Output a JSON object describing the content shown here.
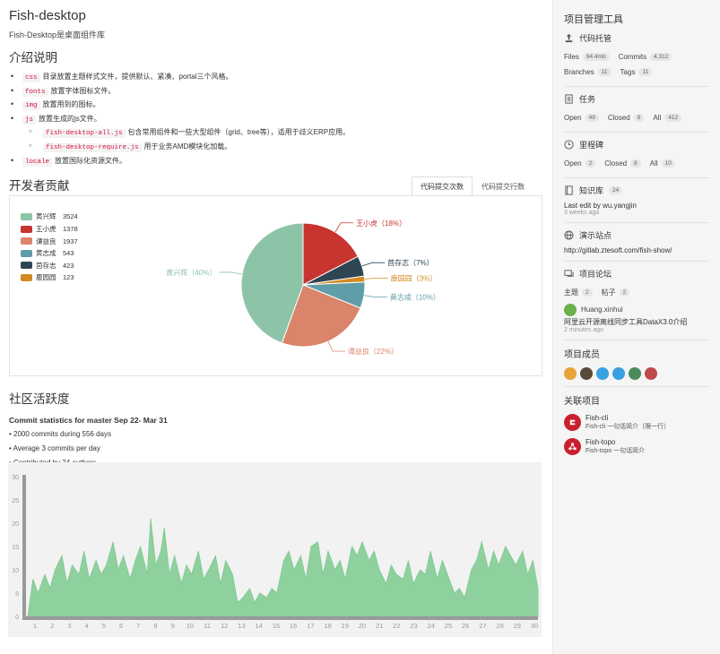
{
  "repo": {
    "title": "Fish-desktop",
    "description": "Fish-Desktop是桌面组件库"
  },
  "intro": {
    "heading": "介绍说明",
    "items": [
      {
        "code": "css",
        "text": "目录放置主题样式文件，提供默认、紧凑、portal三个风格。"
      },
      {
        "code": "fonts",
        "text": "放置字体图标文件。"
      },
      {
        "code": "img",
        "text": "放置用到的图标。"
      },
      {
        "code": "js",
        "text": "放置生成的js文件。"
      },
      {
        "code": "fish-desktop-all.js",
        "text": "包含常用组件和一些大型组件（grid、tree等），适用于歧义ERP应用。"
      },
      {
        "code": "fish-desktop-require.js",
        "text": "用于业务AMD模块化加载。"
      },
      {
        "code": "locale",
        "text": "放置国际化资源文件。"
      }
    ]
  },
  "contributors": {
    "heading": "开发者贡献",
    "tabs": [
      "代码提交次数",
      "代码提交行数"
    ]
  },
  "chart_data": [
    {
      "type": "pie",
      "categories": [
        "黄兴辉",
        "王小虎",
        "谭益良",
        "黄志成",
        "茴存志",
        "鹿园园"
      ],
      "values": [
        3524,
        1378,
        1937,
        543,
        423,
        123
      ],
      "slice_labels": [
        "黄兴辉（40%）",
        "王小虎（18%）",
        "谭益良（22%）",
        "黄志成（10%）",
        "茴存志（7%）",
        "鹿园园（3%）"
      ],
      "colors": [
        "#8dc4a8",
        "#c8342f",
        "#d9846b",
        "#5f9ea8",
        "#2f4554",
        "#d48a22"
      ],
      "legend": "top-left"
    },
    {
      "type": "area",
      "xlabel": "",
      "ylabel": "",
      "ylim": [
        0,
        30
      ],
      "yticks": [
        0,
        5,
        10,
        15,
        20,
        25,
        30
      ],
      "xticks": [
        "1",
        "2",
        "3",
        "4",
        "5",
        "6",
        "7",
        "8",
        "9",
        "10",
        "11",
        "12",
        "13",
        "14",
        "15",
        "16",
        "17",
        "18",
        "19",
        "20",
        "21",
        "22",
        "23",
        "24",
        "25",
        "26",
        "27",
        "28",
        "29",
        "30"
      ],
      "x": [
        0,
        0.3,
        0.6,
        1,
        1.3,
        1.6,
        2,
        2.3,
        2.6,
        3,
        3.3,
        3.6,
        4,
        4.3,
        4.6,
        5,
        5.3,
        5.6,
        6,
        6.3,
        6.6,
        7,
        7.2,
        7.5,
        7.8,
        8,
        8.3,
        8.6,
        9,
        9.3,
        9.6,
        10,
        10.3,
        10.6,
        11,
        11.3,
        11.6,
        12,
        12.3,
        12.6,
        13,
        13.3,
        13.6,
        14,
        14.3,
        14.6,
        15,
        15.3,
        15.6,
        16,
        16.3,
        16.6,
        17,
        17.3,
        17.6,
        18,
        18.3,
        18.6,
        19,
        19.3,
        19.6,
        20,
        20.3,
        20.6,
        21,
        21.3,
        21.6,
        22,
        22.3,
        22.6,
        23,
        23.3,
        23.6,
        24,
        24.3,
        24.6,
        25,
        25.3,
        25.6,
        26,
        26.3,
        26.6,
        27,
        27.3,
        27.6,
        28,
        28.3,
        28.6,
        29,
        29.3,
        29.6,
        29.9
      ],
      "values": [
        0,
        8,
        5,
        9,
        6,
        10,
        13,
        7,
        11,
        9,
        14,
        8,
        12,
        9,
        11,
        16,
        10,
        13,
        8,
        12,
        15,
        9,
        21,
        11,
        14,
        19,
        9,
        13,
        7,
        11,
        9,
        14,
        8,
        10,
        13,
        7,
        12,
        9,
        3,
        4,
        6,
        3,
        5,
        4,
        6,
        5,
        12,
        14,
        10,
        13,
        8,
        15,
        16,
        9,
        14,
        10,
        12,
        8,
        15,
        13,
        16,
        12,
        14,
        10,
        7,
        11,
        9,
        8,
        12,
        7,
        10,
        9,
        14,
        8,
        12,
        9,
        5,
        6,
        4,
        10,
        12,
        16,
        10,
        14,
        11,
        15,
        13,
        11,
        14,
        9,
        12,
        6,
        3
      ]
    }
  ],
  "activity": {
    "heading": "社区活跃度",
    "commit_title": "Commit statistics for master Sep 22- Mar 31",
    "stats": [
      "2000 commits during 556 days",
      "Average 3 commits per day",
      "Contributed by 24 authors"
    ]
  },
  "sidebar": {
    "title": "项目管理工具",
    "hosting": {
      "heading": "代码托管",
      "files_label": "Files",
      "files_value": "94.4mb",
      "commits_label": "Commits",
      "commits_value": "4,312",
      "branches_label": "Branches",
      "branches_value": "11",
      "tags_label": "Tags",
      "tags_value": "11"
    },
    "tasks": {
      "heading": "任务",
      "open_label": "Open",
      "open_value": "49",
      "closed_label": "Closed",
      "closed_value": "8",
      "all_label": "All",
      "all_value": "412"
    },
    "milestones": {
      "heading": "里程碑",
      "open_label": "Open",
      "open_value": "2",
      "closed_label": "Closed",
      "closed_value": "8",
      "all_label": "All",
      "all_value": "10"
    },
    "wiki": {
      "heading": "知识库",
      "count": "24",
      "last_edit": "Last edit by wu.yangjin",
      "time": "3 weeks ago"
    },
    "demo": {
      "heading": "演示站点",
      "url": "http://gitlab.ztesoft.com/fish-show/"
    },
    "forum": {
      "heading": "项目论坛",
      "topics_label": "主题",
      "topics_value": "2",
      "posts_label": "帖子",
      "posts_value": "2",
      "author": "Huang.xinhui",
      "post_title": "阿里云开源离线同步工具DataX3.0介绍",
      "time": "2 minutes ago"
    },
    "members": {
      "heading": "项目成员"
    },
    "related": {
      "heading": "关联项目",
      "items": [
        {
          "name": "Fish-cli",
          "desc": "Fish-cli 一句话简介（限一行）",
          "color": "#c9202f"
        },
        {
          "name": "Fish-topo",
          "desc": "Fish-topo 一句话简介",
          "color": "#c9202f"
        }
      ]
    }
  }
}
